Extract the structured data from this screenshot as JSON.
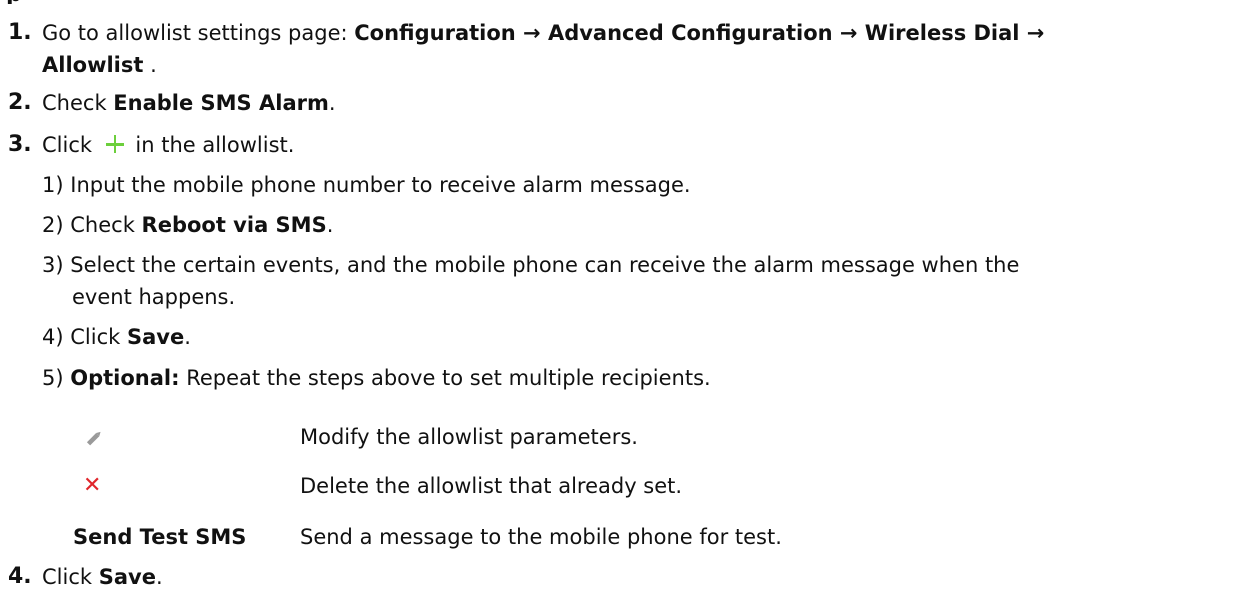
{
  "steps": [
    {
      "num": "1.",
      "pre": "Go to allowlist settings page: ",
      "path_line1": "Configuration → Advanced Configuration → Wireless Dial →",
      "path_line2": "Allowlist",
      "post": " ."
    },
    {
      "num": "2.",
      "pre": "Check ",
      "bold": "Enable SMS Alarm",
      "post": "."
    },
    {
      "num": "3.",
      "pre": "Click ",
      "icon": "plus-icon",
      "post": " in the allowlist.",
      "substeps": [
        {
          "num": "1)",
          "text": "Input the mobile phone number to receive alarm message."
        },
        {
          "num": "2)",
          "pre": "Check ",
          "bold": "Reboot via SMS",
          "post": "."
        },
        {
          "num": "3)",
          "text_line1": "Select the certain events, and the mobile phone can receive the alarm message when the",
          "text_line2": "event happens."
        },
        {
          "num": "4)",
          "pre": "Click ",
          "bold": "Save",
          "post": "."
        },
        {
          "num": "5)",
          "bold": "Optional:",
          "post": " Repeat the steps above to set multiple recipients."
        }
      ]
    },
    {
      "num": "4.",
      "pre": "Click ",
      "bold": "Save",
      "post": "."
    }
  ],
  "icon_table": [
    {
      "icon": "pencil-icon",
      "description": "Modify the allowlist parameters."
    },
    {
      "icon": "close-icon",
      "description": "Delete the allowlist that already set."
    },
    {
      "label": "Send Test SMS",
      "description": "Send a message to the mobile phone for test."
    }
  ],
  "colors": {
    "plus_icon": "#6ccf3c",
    "close_icon": "#e0262b",
    "pencil_icon": "#9a9a9a"
  }
}
